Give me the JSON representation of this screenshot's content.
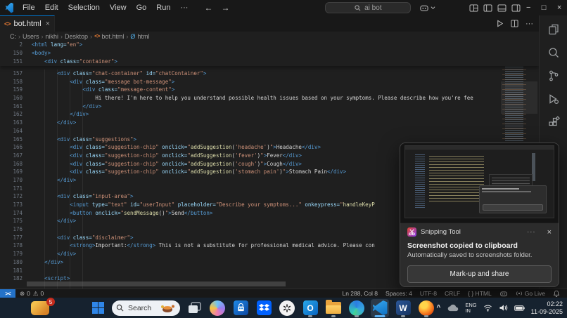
{
  "colors": {
    "accent": "#0078d4",
    "remote_blue": "#2472c8",
    "editor_bg": "#1f1f1f",
    "shell_bg": "#181818",
    "taskbar_bg": "#16222f",
    "badge_red": "#c42b1c",
    "code_tag": "#569cd6",
    "code_attr": "#9cdcfe",
    "code_string": "#ce9178",
    "code_func": "#dcdcaa",
    "code_text": "#d4d4d4",
    "line_number": "#6e7681",
    "html_file_icon_orange": "#e37933"
  },
  "icons": {
    "titlebar": [
      "vscode-logo",
      "back-arrow",
      "forward-arrow",
      "search-icon",
      "copilot-icon",
      "chevron-down-icon",
      "layout-grid-icon",
      "panel-left-icon",
      "panel-bottom-icon",
      "panel-right-icon",
      "minimize-icon",
      "maximize-icon",
      "close-icon"
    ],
    "activitybar": [
      "explorer-icon",
      "search-icon",
      "source-control-icon",
      "run-debug-icon",
      "extensions-icon"
    ],
    "taskbar": [
      "widgets-icon",
      "start-icon",
      "search-icon",
      "task-view-icon",
      "copilot-icon",
      "store-icon",
      "dropbox-icon",
      "chatgpt-icon",
      "outlook-icon",
      "file-explorer-icon",
      "edge-icon",
      "vscode-icon",
      "word-icon",
      "firefox-icon",
      "chevron-up-icon",
      "onedrive-icon",
      "wifi-icon",
      "volume-icon",
      "battery-icon"
    ]
  },
  "titlebar": {
    "menus": [
      "File",
      "Edit",
      "Selection",
      "View",
      "Go",
      "Run",
      "···"
    ],
    "back": "←",
    "forward": "→",
    "search": "ai bot",
    "minimize": "−",
    "maximize": "□",
    "close": "×"
  },
  "tab": {
    "label": "bot.html",
    "close": "×",
    "file_icon": "<>"
  },
  "breadcrumb": {
    "items": [
      "C:",
      "Users",
      "nikhi",
      "Desktop",
      "bot.html",
      "html"
    ],
    "sep": "›",
    "sym": "Ø"
  },
  "editor": {
    "sticky": [
      {
        "n": "2",
        "i": 0,
        "tk": [
          [
            "g",
            "<html"
          ],
          [
            "a",
            " lang="
          ],
          [
            "s",
            "\"en\""
          ],
          [
            "g",
            ">"
          ]
        ]
      },
      {
        "n": "150",
        "i": 0,
        "tk": [
          [
            "g",
            "<body>"
          ]
        ]
      },
      {
        "n": "151",
        "i": 4,
        "tk": [
          [
            "g",
            "<div"
          ],
          [
            "a",
            " class="
          ],
          [
            "s",
            "\"container\""
          ],
          [
            "g",
            ">"
          ]
        ]
      }
    ],
    "lines": [
      {
        "n": "157",
        "i": 8,
        "tk": [
          [
            "g",
            "<div"
          ],
          [
            "a",
            " class="
          ],
          [
            "s",
            "\"chat-container\""
          ],
          [
            "a",
            " id="
          ],
          [
            "s",
            "\"chatContainer\""
          ],
          [
            "g",
            ">"
          ]
        ]
      },
      {
        "n": "158",
        "i": 12,
        "tk": [
          [
            "g",
            "<div"
          ],
          [
            "a",
            " class="
          ],
          [
            "s",
            "\"message bot-message\""
          ],
          [
            "g",
            ">"
          ]
        ]
      },
      {
        "n": "159",
        "i": 16,
        "tk": [
          [
            "g",
            "<div"
          ],
          [
            "a",
            " class="
          ],
          [
            "s",
            "\"message-content\""
          ],
          [
            "g",
            ">"
          ]
        ]
      },
      {
        "n": "160",
        "i": 20,
        "tk": [
          [
            "t",
            "Hi there! I'm here to help you understand possible health issues based on your symptoms. Please describe how you're fee"
          ]
        ]
      },
      {
        "n": "161",
        "i": 16,
        "tk": [
          [
            "g",
            "</div>"
          ]
        ]
      },
      {
        "n": "162",
        "i": 12,
        "tk": [
          [
            "g",
            "</div>"
          ]
        ]
      },
      {
        "n": "163",
        "i": 8,
        "tk": [
          [
            "g",
            "</div>"
          ]
        ]
      },
      {
        "n": "164",
        "i": 0,
        "tk": []
      },
      {
        "n": "165",
        "i": 8,
        "tk": [
          [
            "g",
            "<div"
          ],
          [
            "a",
            " class="
          ],
          [
            "s",
            "\"suggestions\""
          ],
          [
            "g",
            ">"
          ]
        ]
      },
      {
        "n": "166",
        "i": 12,
        "tk": [
          [
            "g",
            "<div"
          ],
          [
            "a",
            " class="
          ],
          [
            "s",
            "\"suggestion-chip\""
          ],
          [
            "a",
            " onclick="
          ],
          [
            "s",
            "\""
          ],
          [
            "f",
            "addSuggestion"
          ],
          [
            "t",
            "("
          ],
          [
            "s",
            "'headache'"
          ],
          [
            "t",
            ")"
          ],
          [
            "s",
            "\""
          ],
          [
            "g",
            ">"
          ],
          [
            "t",
            "Headache"
          ],
          [
            "g",
            "</div>"
          ]
        ]
      },
      {
        "n": "167",
        "i": 12,
        "tk": [
          [
            "g",
            "<div"
          ],
          [
            "a",
            " class="
          ],
          [
            "s",
            "\"suggestion-chip\""
          ],
          [
            "a",
            " onclick="
          ],
          [
            "s",
            "\""
          ],
          [
            "f",
            "addSuggestion"
          ],
          [
            "t",
            "("
          ],
          [
            "s",
            "'fever'"
          ],
          [
            "t",
            ")"
          ],
          [
            "s",
            "\""
          ],
          [
            "g",
            ">"
          ],
          [
            "t",
            "Fever"
          ],
          [
            "g",
            "</div>"
          ]
        ]
      },
      {
        "n": "168",
        "i": 12,
        "tk": [
          [
            "g",
            "<div"
          ],
          [
            "a",
            " class="
          ],
          [
            "s",
            "\"suggestion-chip\""
          ],
          [
            "a",
            " onclick="
          ],
          [
            "s",
            "\""
          ],
          [
            "f",
            "addSuggestion"
          ],
          [
            "t",
            "("
          ],
          [
            "s",
            "'cough'"
          ],
          [
            "t",
            ")"
          ],
          [
            "s",
            "\""
          ],
          [
            "g",
            ">"
          ],
          [
            "t",
            "Cough"
          ],
          [
            "g",
            "</div>"
          ]
        ]
      },
      {
        "n": "169",
        "i": 12,
        "tk": [
          [
            "g",
            "<div"
          ],
          [
            "a",
            " class="
          ],
          [
            "s",
            "\"suggestion-chip\""
          ],
          [
            "a",
            " onclick="
          ],
          [
            "s",
            "\""
          ],
          [
            "f",
            "addSuggestion"
          ],
          [
            "t",
            "("
          ],
          [
            "s",
            "'stomach pain'"
          ],
          [
            "t",
            ")"
          ],
          [
            "s",
            "\""
          ],
          [
            "g",
            ">"
          ],
          [
            "t",
            "Stomach Pain"
          ],
          [
            "g",
            "</div>"
          ]
        ]
      },
      {
        "n": "170",
        "i": 8,
        "tk": [
          [
            "g",
            "</div>"
          ]
        ]
      },
      {
        "n": "171",
        "i": 0,
        "tk": []
      },
      {
        "n": "172",
        "i": 8,
        "tk": [
          [
            "g",
            "<div"
          ],
          [
            "a",
            " class="
          ],
          [
            "s",
            "\"input-area\""
          ],
          [
            "g",
            ">"
          ]
        ]
      },
      {
        "n": "173",
        "i": 12,
        "tk": [
          [
            "g",
            "<input"
          ],
          [
            "a",
            " type="
          ],
          [
            "s",
            "\"text\""
          ],
          [
            "a",
            " id="
          ],
          [
            "s",
            "\"userInput\""
          ],
          [
            "a",
            " placeholder="
          ],
          [
            "s",
            "\"Describe your symptoms...\""
          ],
          [
            "a",
            " onkeypress="
          ],
          [
            "s",
            "\""
          ],
          [
            "f",
            "handleKeyP"
          ]
        ]
      },
      {
        "n": "174",
        "i": 12,
        "tk": [
          [
            "g",
            "<button"
          ],
          [
            "a",
            " onclick="
          ],
          [
            "s",
            "\""
          ],
          [
            "f",
            "sendMessage"
          ],
          [
            "t",
            "()"
          ],
          [
            "s",
            "\""
          ],
          [
            "g",
            ">"
          ],
          [
            "t",
            "Send"
          ],
          [
            "g",
            "</button>"
          ]
        ]
      },
      {
        "n": "175",
        "i": 8,
        "tk": [
          [
            "g",
            "</div>"
          ]
        ]
      },
      {
        "n": "176",
        "i": 0,
        "tk": []
      },
      {
        "n": "177",
        "i": 8,
        "tk": [
          [
            "g",
            "<div"
          ],
          [
            "a",
            " class="
          ],
          [
            "s",
            "\"disclaimer\""
          ],
          [
            "g",
            ">"
          ]
        ]
      },
      {
        "n": "178",
        "i": 12,
        "tk": [
          [
            "g",
            "<strong>"
          ],
          [
            "t",
            "Important:"
          ],
          [
            "g",
            "</strong>"
          ],
          [
            "t",
            " This is not a substitute for professional medical advice. Please con"
          ]
        ]
      },
      {
        "n": "179",
        "i": 8,
        "tk": [
          [
            "g",
            "</div>"
          ]
        ]
      },
      {
        "n": "180",
        "i": 4,
        "tk": [
          [
            "g",
            "</div>"
          ]
        ]
      },
      {
        "n": "181",
        "i": 0,
        "tk": []
      },
      {
        "n": "182",
        "i": 4,
        "tk": [
          [
            "g",
            "<script"
          ],
          [
            "g",
            ">"
          ]
        ]
      }
    ]
  },
  "statusbar": {
    "remote": "><",
    "errors": "0",
    "warnings": "0",
    "cursor": "Ln 288, Col 8",
    "spaces": "Spaces: 4",
    "encoding": "UTF-8",
    "eol": "CRLF",
    "lang_mode": "{ } HTML",
    "golive": "Go Live"
  },
  "toast": {
    "app": "Snipping Tool",
    "more": "···",
    "close": "×",
    "title": "Screenshot copied to clipboard",
    "body": "Automatically saved to screenshots folder.",
    "action": "Mark-up and share"
  },
  "taskbar": {
    "widgets_badge": "5",
    "search_placeholder": "Search",
    "lang_line1": "ENG",
    "lang_line2": "IN",
    "time": "02:22",
    "date": "11-09-2025",
    "tray_caret": "^"
  }
}
